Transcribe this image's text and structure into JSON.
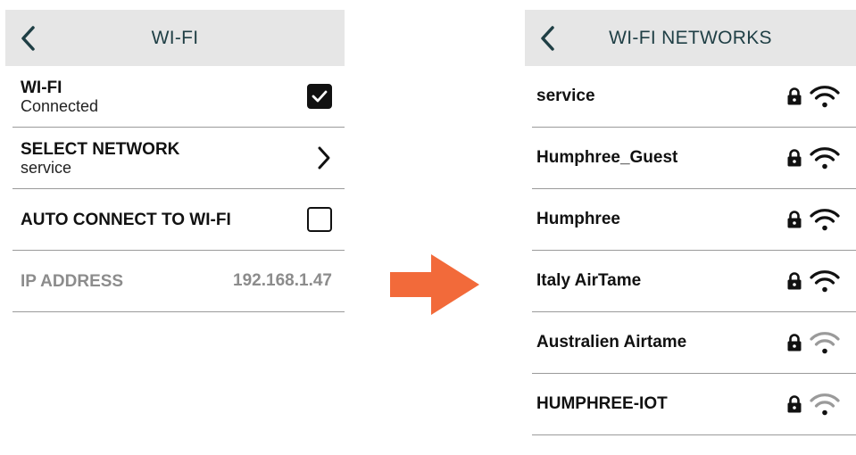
{
  "wifi_screen": {
    "title": "WI-FI",
    "rows": {
      "wifi": {
        "title": "WI-FI",
        "subtitle": "Connected",
        "checked": true
      },
      "select_network": {
        "title": "SELECT NETWORK",
        "subtitle": "service"
      },
      "auto_connect": {
        "title": "AUTO CONNECT TO WI-FI",
        "checked": false
      },
      "ip_address": {
        "title": "IP ADDRESS",
        "value": "192.168.1.47"
      }
    }
  },
  "networks_screen": {
    "title": "WI-FI NETWORKS",
    "networks": [
      {
        "name": "service",
        "locked": true,
        "signal": "full"
      },
      {
        "name": "Humphree_Guest",
        "locked": true,
        "signal": "full"
      },
      {
        "name": "Humphree",
        "locked": true,
        "signal": "full"
      },
      {
        "name": "Italy AirTame",
        "locked": true,
        "signal": "full"
      },
      {
        "name": "Australien Airtame",
        "locked": true,
        "signal": "weak"
      },
      {
        "name": "HUMPHREE-IOT",
        "locked": true,
        "signal": "weak"
      }
    ]
  },
  "icons": {
    "back": "chevron-left-icon",
    "forward": "chevron-right-icon",
    "lock": "lock-icon",
    "wifi": "wifi-signal-icon",
    "transition": "arrow-right-icon"
  },
  "colors": {
    "header_bg": "#e6e6e6",
    "header_text": "#1f3f45",
    "arrow": "#f26a3a",
    "disabled_text": "#8c8c8c",
    "wifi_weak": "#9a9a9a"
  }
}
